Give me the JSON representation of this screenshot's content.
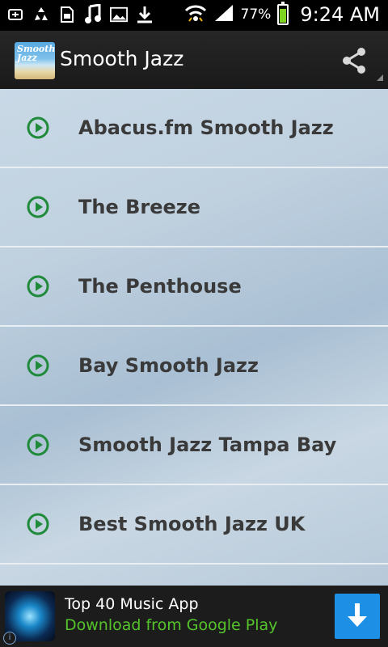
{
  "status_bar": {
    "battery_percent": "77%",
    "battery_level": 0.77,
    "time": "9:24 AM",
    "icons": [
      "usb-debug-icon",
      "recycle-icon",
      "sd-card-icon",
      "music-note-icon",
      "image-icon",
      "download-icon",
      "wifi-icon",
      "signal-icon",
      "battery-icon"
    ]
  },
  "action_bar": {
    "app_icon_text": "Smooth Jazz",
    "title": "Smooth Jazz",
    "share_icon": "share-icon"
  },
  "stations": [
    {
      "label": "Abacus.fm Smooth Jazz"
    },
    {
      "label": "The Breeze"
    },
    {
      "label": "The Penthouse"
    },
    {
      "label": "Bay Smooth Jazz"
    },
    {
      "label": "Smooth Jazz Tampa Bay"
    },
    {
      "label": "Best Smooth Jazz UK"
    }
  ],
  "ad": {
    "title": "Top 40 Music App",
    "subtitle": "Download from Google Play",
    "info_glyph": "i",
    "download_icon": "download-arrow-icon"
  },
  "colors": {
    "play_icon_green": "#1f8a3a",
    "ad_subtitle_green": "#55c42b",
    "ad_button_blue": "#1d8fe5"
  }
}
